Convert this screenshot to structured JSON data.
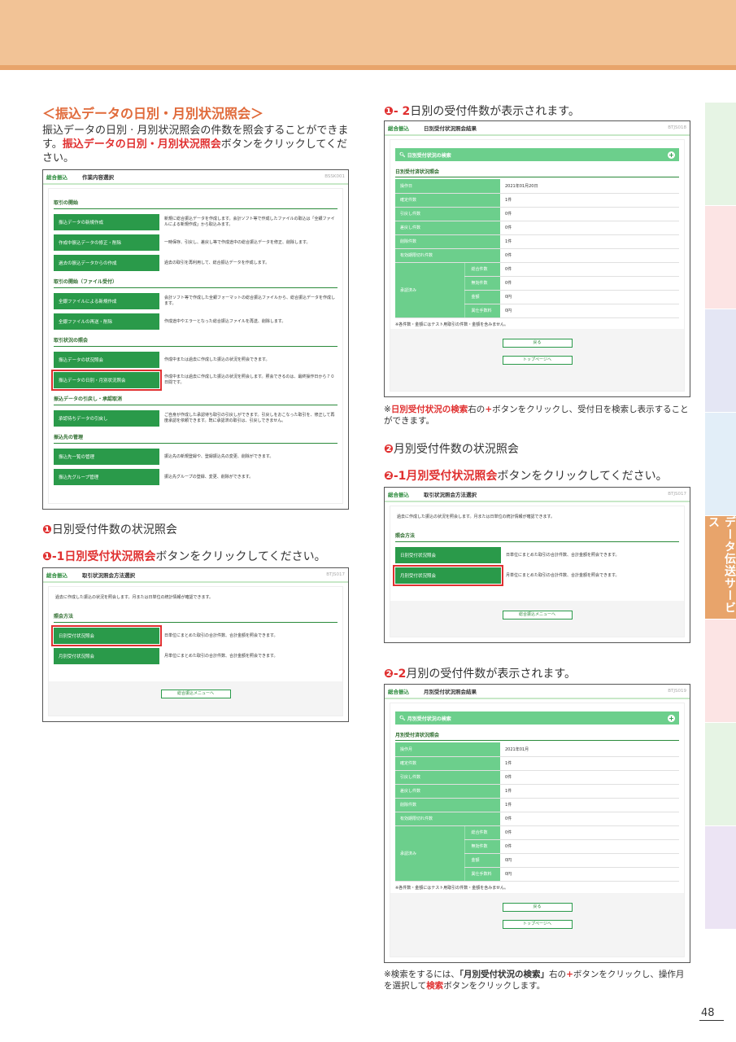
{
  "page": {
    "number": "48",
    "side_tab": "データ伝送サービス"
  },
  "left": {
    "title": "＜振込データの日別・月別状況照会＞",
    "intro_pre": "振込データの日別 · 月別状況照会の件数を照会することができます。",
    "intro_hl": "振込データの日別・月別状況照会",
    "intro_post": "ボタンをクリックしてください。",
    "shot1": {
      "brand": "総合振込",
      "title": "作業内容選択",
      "code": "BSSK001",
      "groups": [
        {
          "title": "取引の開始",
          "items": [
            {
              "label": "振込データの新規作成",
              "desc": "新規に総合振込データを作成します。会計ソフト等で作成したファイルの取込は「全銀ファイルによる新規作成」から取込みます。"
            },
            {
              "label": "作成中振込データの修正・削除",
              "desc": "一時保存、引戻し、差戻し等で作成途中の総合振込データを修正、削除します。"
            },
            {
              "label": "過去の振込データからの作成",
              "desc": "過去の取引を再利用して、総合振込データを作成します。"
            }
          ]
        },
        {
          "title": "取引の開始（ファイル受付）",
          "items": [
            {
              "label": "全銀ファイルによる新規作成",
              "desc": "会計ソフト等で作成した全銀フォーマットの総合振込ファイルから、総合振込データを作成します。"
            },
            {
              "label": "全銀ファイルの再送・削除",
              "desc": "作成途中やエラーとなった総合振込ファイルを再送、削除します。"
            }
          ]
        },
        {
          "title": "取引状況の照会",
          "items": [
            {
              "label": "振込データの状況照会",
              "desc": "作成中または過去に作成した振込の状況を照会できます。"
            },
            {
              "label": "振込データの日別・月別状況照会",
              "desc": "作成中または過去に作成した振込の状況を照会します。照会できるのは、最終操作日から７０日間です。",
              "selected": true
            }
          ]
        },
        {
          "title": "振込データの引戻し・承認取消",
          "items": [
            {
              "label": "承認待ちデータの引戻し",
              "desc": "ご自身が作成した承認待ち取引の引戻しができます。引戻しをおこなった取引を、修正して再度承認を依頼できます。既に承認済の取引は、引戻しできません。"
            }
          ]
        },
        {
          "title": "振込先の管理",
          "items": [
            {
              "label": "振込先一覧の管理",
              "desc": "振込先の新規登録や、登録振込先の変更、削除ができます。"
            },
            {
              "label": "振込先グループ管理",
              "desc": "振込先グループの登録、変更、削除ができます。"
            }
          ]
        }
      ]
    },
    "step1_num": "❶",
    "step1_text": "日別受付件数の状況照会",
    "step1_1_num": "❶-1",
    "step1_1_hl": "日別受付状況照会",
    "step1_1_post": "ボタンをクリックしてください。",
    "shot2": {
      "brand": "総合振込",
      "title": "取引状況照会方法選択",
      "code": "BTJS017",
      "desc": "過去に作成した振込の状況を照会します。月または日単位の統計情報が確認できます。",
      "group": "照会方法",
      "items": [
        {
          "label": "日別受付状況照会",
          "desc": "日単位にまとめた取引の合計件数、合計金額を照会できます。"
        },
        {
          "label": "月別受付状況照会",
          "desc": "月単位にまとめた取引の合計件数、合計金額を照会できます。"
        }
      ],
      "menu_btn": "総合振込メニューへ"
    }
  },
  "right": {
    "step1_2_num": "❶- 2",
    "step1_2_text": "日別の受付件数が表示されます。",
    "shot3": {
      "brand": "総合振込",
      "title": "日別受付状況照会結果",
      "code": "BTJS018",
      "search": "日別受付状況の検索",
      "result_title": "日別受付済状況照会",
      "rows": [
        {
          "k": "操作日",
          "v": "2021年01月20日"
        },
        {
          "k": "確定件数",
          "v": "1件"
        },
        {
          "k": "引戻し件数",
          "v": "0件"
        },
        {
          "k": "差戻し件数",
          "v": "0件"
        },
        {
          "k": "削除件数",
          "v": "1件"
        },
        {
          "k": "有効期限切れ件数",
          "v": "0件"
        }
      ],
      "sub_label": "承認済み",
      "sub_rows": [
        {
          "k": "総合件数",
          "v": "0件"
        },
        {
          "k": "無効件数",
          "v": "0件"
        },
        {
          "k": "金額",
          "v": "0円"
        },
        {
          "k": "異仕手数料",
          "v": "0円"
        }
      ],
      "note": "※各件数・金額にはテスト用取引の件数・金額を含みません。",
      "back": "戻る",
      "top": "トップページへ"
    },
    "note1_pre": "※",
    "note1_hl": "日別受付状況の検索",
    "note1_mid": "右の",
    "note1_plus": "+",
    "note1_post": "ボタンをクリックし、受付日を検索し表示することができます。",
    "step2_num": "❷",
    "step2_text": "月別受付件数の状況照会",
    "step2_1_num": "❷-1",
    "step2_1_hl": "月別受付状況照会",
    "step2_1_post": "ボタンをクリックしてください。",
    "shot4": {
      "brand": "総合振込",
      "title": "取引状況照会方法選択",
      "code": "BTJS017",
      "desc": "過去に作成した振込の状況を照会します。月または日単位の統計情報が確認できます。",
      "group": "照会方法",
      "items": [
        {
          "label": "日別受付状況照会",
          "desc": "日単位にまとめた取引の合計件数、合計金額を照会できます。"
        },
        {
          "label": "月別受付状況照会",
          "desc": "月単位にまとめた取引の合計件数、合計金額を照会できます。"
        }
      ],
      "menu_btn": "総合振込メニューへ"
    },
    "step2_2_num": "❷-2",
    "step2_2_text": "月別の受付件数が表示されます。",
    "shot5": {
      "brand": "総合振込",
      "title": "月別受付状況照会結果",
      "code": "BTJS019",
      "search": "月別受付状況の検索",
      "result_title": "月別受付済状況照会",
      "rows": [
        {
          "k": "操作月",
          "v": "2021年01月"
        },
        {
          "k": "確定件数",
          "v": "1件"
        },
        {
          "k": "引戻し件数",
          "v": "0件"
        },
        {
          "k": "差戻し件数",
          "v": "1件"
        },
        {
          "k": "削除件数",
          "v": "1件"
        },
        {
          "k": "有効期限切れ件数",
          "v": "0件"
        }
      ],
      "sub_label": "承認済み",
      "sub_rows": [
        {
          "k": "総合件数",
          "v": "0件"
        },
        {
          "k": "無効件数",
          "v": "0件"
        },
        {
          "k": "金額",
          "v": "0円"
        },
        {
          "k": "異仕手数料",
          "v": "0円"
        }
      ],
      "note": "※各件数・金額にはテスト用取引の件数・金額を含みません。",
      "back": "戻る",
      "top": "トップページへ"
    },
    "note2_pre": "※検索をするには、",
    "note2_hl": "「月別受付状況の検索」",
    "note2_mid": "右の",
    "note2_plus": "+",
    "note2_mid2": "ボタンをクリックし、操作月を選択して",
    "note2_hl2": "検索",
    "note2_post": "ボタンをクリックします。"
  }
}
